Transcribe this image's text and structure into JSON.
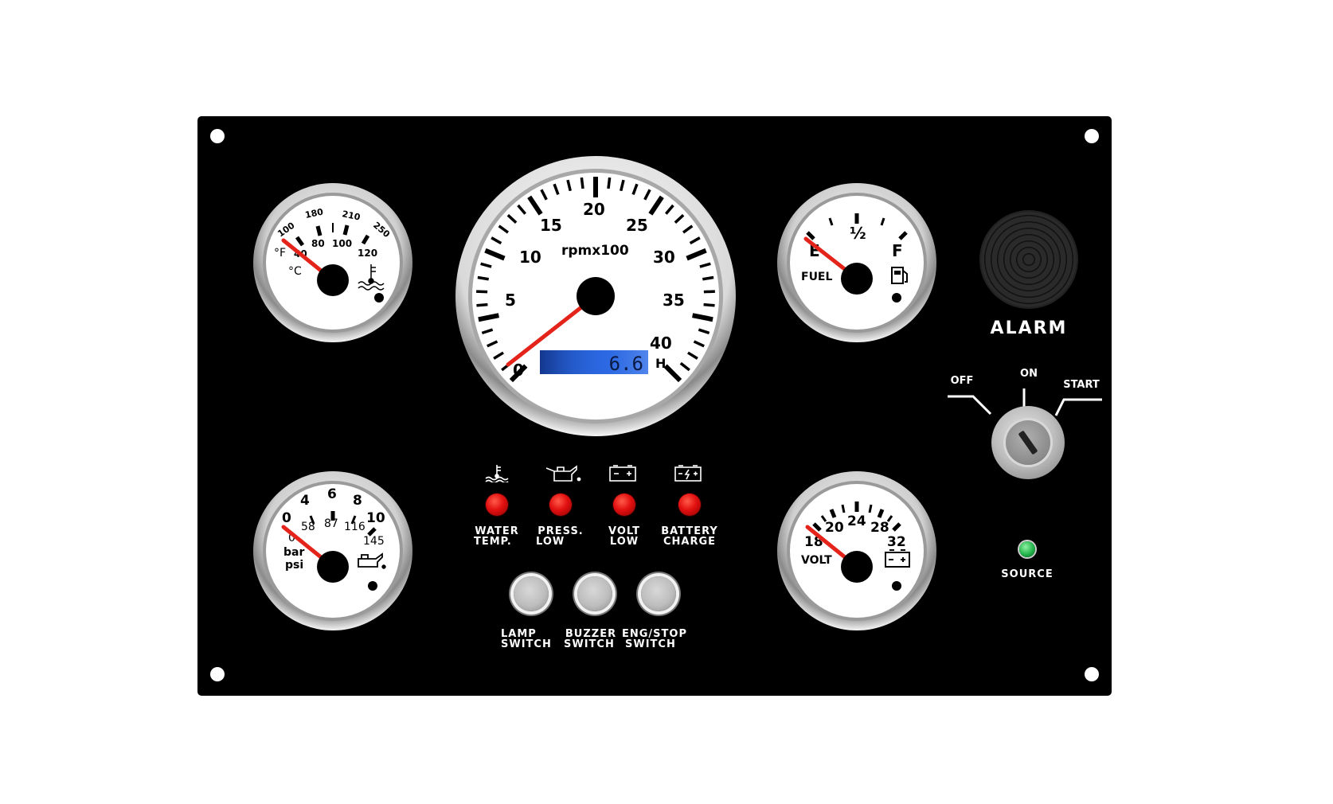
{
  "temp_gauge": {
    "fahrenheit_ticks": [
      "100",
      "180",
      "210",
      "250"
    ],
    "celsius_ticks": [
      "40",
      "80",
      "100",
      "120"
    ],
    "unit_f": "°F",
    "unit_c": "°C",
    "icon": "coolant-temperature-icon",
    "needle_value_celsius": 40
  },
  "tachometer": {
    "ticks": [
      "0",
      "5",
      "10",
      "15",
      "20",
      "25",
      "30",
      "35",
      "40"
    ],
    "unit": "rpmx100",
    "hour_display": "6.6",
    "hour_unit": "H",
    "needle_value": 0
  },
  "fuel_gauge": {
    "empty_label": "E",
    "half_label": "½",
    "full_label": "F",
    "name": "FUEL",
    "icon": "fuel-pump-icon",
    "needle_value": 0
  },
  "oil_pressure_gauge": {
    "bar_ticks": [
      "0",
      "4",
      "6",
      "8",
      "10"
    ],
    "psi_ticks": [
      "0",
      "58",
      "87",
      "116",
      "145"
    ],
    "unit_bar": "bar",
    "unit_psi": "psi",
    "icon": "oil-can-icon",
    "needle_value_bar": 0
  },
  "volt_gauge": {
    "ticks": [
      "18",
      "20",
      "24",
      "28",
      "32"
    ],
    "name": "VOLT",
    "icon": "battery-icon",
    "needle_value": 18
  },
  "alarm": {
    "label": "ALARM"
  },
  "ignition": {
    "off_label": "OFF",
    "on_label": "ON",
    "start_label": "START",
    "position": "OFF"
  },
  "source": {
    "label": "SOURCE",
    "color": "#22b34a"
  },
  "warning_lights": [
    {
      "line1": "WATER",
      "line2": "TEMP.",
      "icon": "water-temp-icon"
    },
    {
      "line1": "PRESS.",
      "line2": "LOW",
      "icon": "oil-pressure-icon"
    },
    {
      "line1": "VOLT",
      "line2": "LOW",
      "icon": "battery-low-icon"
    },
    {
      "line1": "BATTERY",
      "line2": "CHARGE",
      "icon": "battery-charge-icon"
    }
  ],
  "switches": [
    {
      "line1": "LAMP",
      "line2": "SWITCH"
    },
    {
      "line1": "BUZZER",
      "line2": "SWITCH"
    },
    {
      "line1": "ENG/STOP",
      "line2": "SWITCH"
    }
  ],
  "colors": {
    "panel": "#000000",
    "needle": "#e4241b",
    "warning_led": "#e21010",
    "lcd": "#2a66e0"
  }
}
